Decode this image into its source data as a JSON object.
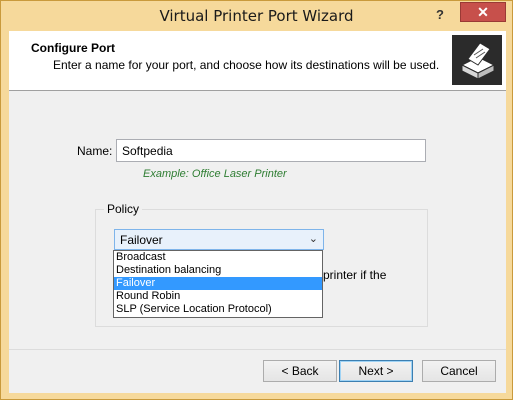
{
  "window": {
    "title": "Virtual Printer Port Wizard",
    "help_label": "?",
    "close_label": "✕"
  },
  "header": {
    "title": "Configure Port",
    "subtitle": "Enter a name for your port, and choose how its destinations will be used.",
    "icon": "printer-icon"
  },
  "form": {
    "name_label": "Name:",
    "name_value": "Softpedia",
    "example": "Example: Office Laser Printer"
  },
  "policy": {
    "legend": "Policy",
    "selected": "Failover",
    "arrow": "⌄",
    "behind_text": "printer if the",
    "options": [
      "Broadcast",
      "Destination balancing",
      "Failover",
      "Round Robin",
      "SLP (Service Location Protocol)"
    ],
    "selected_index": 2
  },
  "buttons": {
    "back": "< Back",
    "next": "Next >",
    "cancel": "Cancel"
  },
  "colors": {
    "title_bar": "#f6d99b",
    "close_button": "#c7504b",
    "selection": "#3399ff",
    "example_text": "#2e7d32"
  }
}
